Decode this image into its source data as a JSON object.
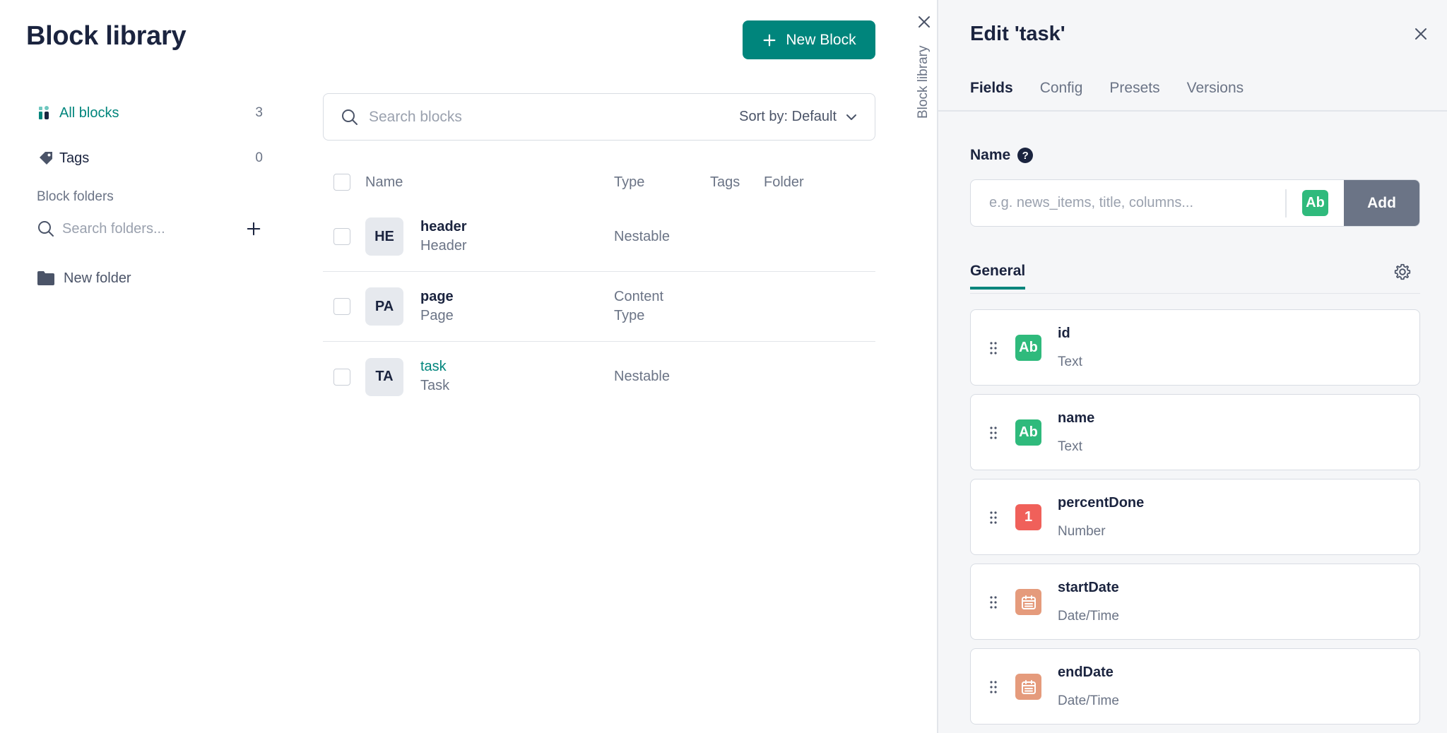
{
  "library": {
    "title": "Block library",
    "new_block_label": "New Block"
  },
  "sidebar": {
    "all_blocks": {
      "label": "All blocks",
      "count": "3"
    },
    "tags": {
      "label": "Tags",
      "count": "0"
    },
    "folders_heading": "Block folders",
    "folder_search_placeholder": "Search folders...",
    "folders": [
      {
        "label": "New folder"
      }
    ]
  },
  "search": {
    "placeholder": "Search blocks",
    "sort_label": "Sort by: Default"
  },
  "table": {
    "headers": {
      "name": "Name",
      "type": "Type",
      "tags": "Tags",
      "folder": "Folder"
    },
    "rows": [
      {
        "initials": "HE",
        "name": "header",
        "display": "Header",
        "type": "Nestable"
      },
      {
        "initials": "PA",
        "name": "page",
        "display": "Page",
        "type": "Content Type"
      },
      {
        "initials": "TA",
        "name": "task",
        "display": "Task",
        "type": "Nestable"
      }
    ]
  },
  "strip": {
    "label": "Block library"
  },
  "panel": {
    "title": "Edit 'task'",
    "tabs": [
      "Fields",
      "Config",
      "Presets",
      "Versions"
    ],
    "name_label": "Name",
    "help_glyph": "?",
    "name_placeholder": "e.g. news_items, title, columns...",
    "type_badge": "Ab",
    "add_label": "Add",
    "section_label": "General",
    "fields": [
      {
        "badge": "Ab",
        "name": "id",
        "type": "Text"
      },
      {
        "badge": "Ab",
        "name": "name",
        "type": "Text"
      },
      {
        "badge": "1",
        "name": "percentDone",
        "type": "Number"
      },
      {
        "badge": "",
        "name": "startDate",
        "type": "Date/Time"
      },
      {
        "badge": "",
        "name": "endDate",
        "type": "Date/Time"
      }
    ]
  },
  "colors": {
    "accent": "#00857c",
    "text_badge": "#2fba7c",
    "number_badge": "#f0605a",
    "date_badge": "#e59b7c"
  }
}
